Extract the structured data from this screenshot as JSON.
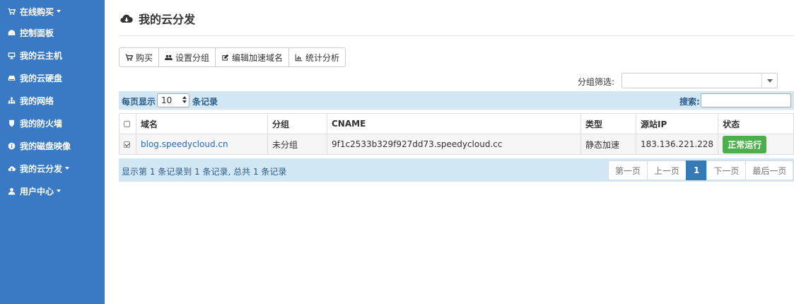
{
  "sidebar": {
    "items": [
      {
        "label": "在线购买",
        "icon": "cart-icon",
        "has_caret": true
      },
      {
        "label": "控制面板",
        "icon": "dashboard-icon",
        "has_caret": false
      },
      {
        "label": "我的云主机",
        "icon": "monitor-icon",
        "has_caret": false
      },
      {
        "label": "我的云硬盘",
        "icon": "hdd-icon",
        "has_caret": false
      },
      {
        "label": "我的网络",
        "icon": "sitemap-icon",
        "has_caret": false
      },
      {
        "label": "我的防火墙",
        "icon": "shield-icon",
        "has_caret": false
      },
      {
        "label": "我的磁盘映像",
        "icon": "info-icon",
        "has_caret": false
      },
      {
        "label": "我的云分发",
        "icon": "cloud-download-icon",
        "has_caret": true
      },
      {
        "label": "用户中心",
        "icon": "user-icon",
        "has_caret": true
      }
    ]
  },
  "page": {
    "title": "我的云分发",
    "title_icon": "cloud-download-icon"
  },
  "toolbar": {
    "buy_label": "购买",
    "set_group_label": "设置分组",
    "edit_domain_label": "编辑加速域名",
    "stats_label": "统计分析"
  },
  "filter": {
    "label": "分组筛选:",
    "value": ""
  },
  "list_controls": {
    "per_page_label": "每页显示",
    "per_page_value": "10",
    "records_label": "条记录",
    "search_label": "搜索:",
    "search_value": ""
  },
  "table": {
    "headers": [
      "域名",
      "分组",
      "CNAME",
      "类型",
      "源站IP",
      "状态"
    ],
    "rows": [
      {
        "checked": true,
        "domain": "blog.speedycloud.cn",
        "group": "未分组",
        "cname": "9f1c2533b329f927dd73.speedycloud.cc",
        "type": "静态加速",
        "origin_ip": "183.136.221.228",
        "status": "正常运行"
      }
    ]
  },
  "footer": {
    "info": "显示第 1 条记录到 1 条记录, 总共 1 条记录"
  },
  "pagination": {
    "first": "第一页",
    "prev": "上一页",
    "current": "1",
    "next": "下一页",
    "last": "最后一页"
  },
  "colors": {
    "sidebar_bg": "#3a7ac5",
    "status_green": "#4cae4c",
    "pager_active": "#337ab7",
    "bar_bg": "#d2e7f4"
  }
}
